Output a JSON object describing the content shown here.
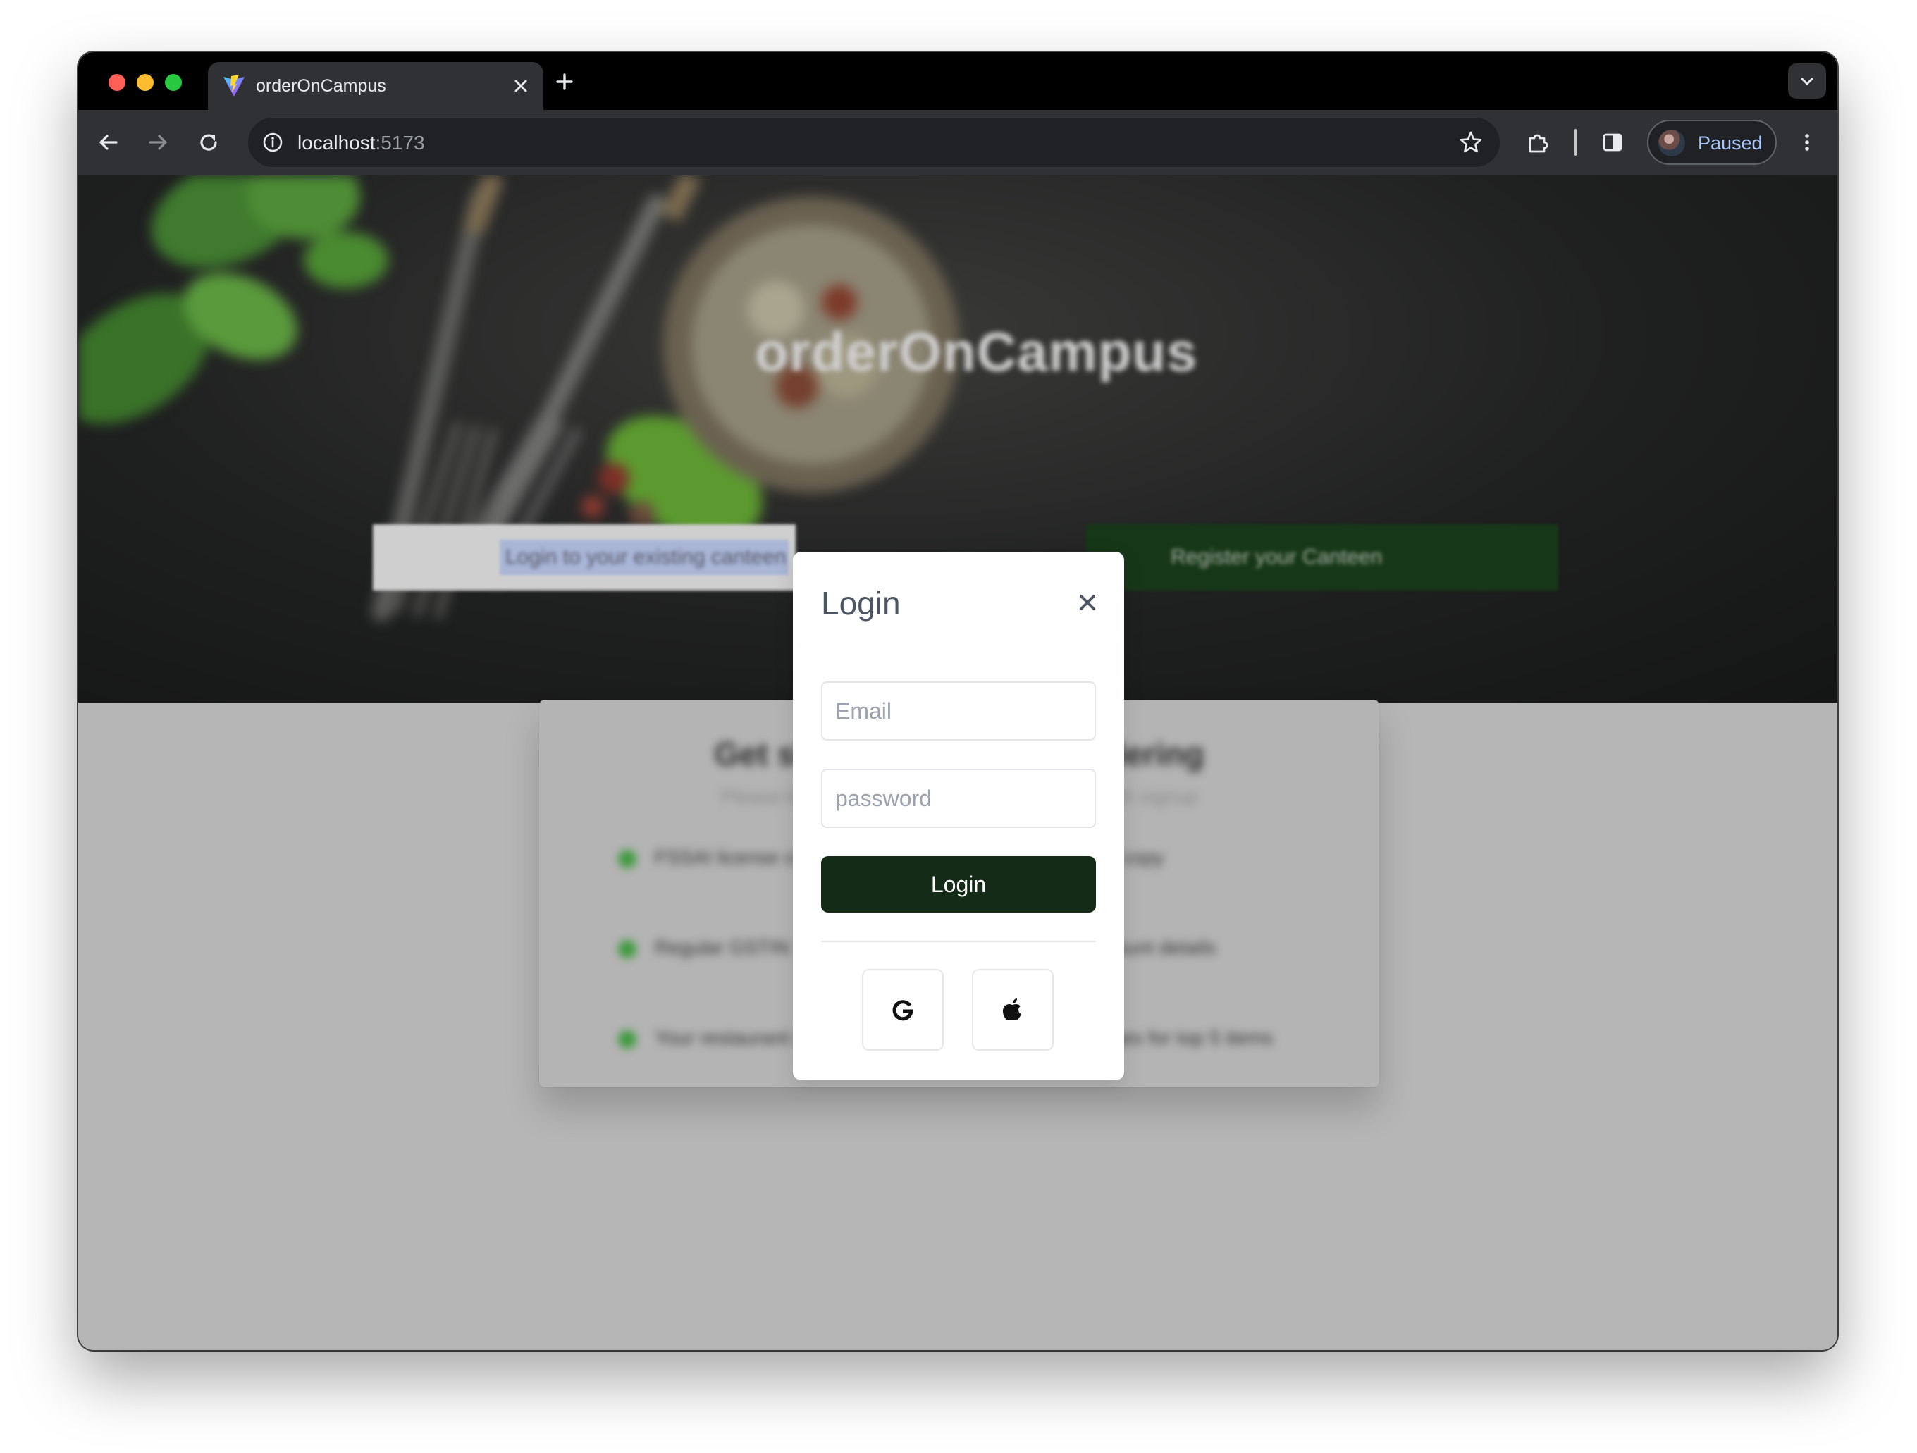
{
  "browser": {
    "tab": {
      "title": "orderOnCampus"
    },
    "address": {
      "host": "localhost",
      "port": ":5173"
    },
    "profile": {
      "label": "Paused"
    }
  },
  "page": {
    "brand": "orderOnCampus",
    "hero_buttons": {
      "existing": "Login to your existing canteen",
      "register": "Register your Canteen"
    },
    "card": {
      "title": "Get started with online ordering",
      "subtitle": "Please keep the documents ready for a smooth signup",
      "bullets_left": [
        "FSSAI license copy",
        "Regular GSTIN",
        "Your restaurant menu"
      ],
      "bullets_right": [
        "PAN card copy",
        "Bank account details",
        "Dish images for top 5 items"
      ]
    }
  },
  "modal": {
    "title": "Login",
    "email_placeholder": "Email",
    "password_placeholder": "password",
    "login_label": "Login",
    "social": [
      "google-icon",
      "apple-icon"
    ]
  },
  "colors": {
    "login_button": "#132b17",
    "register_button": "#173818",
    "bullet": "#3d9a3d",
    "profile_label": "#a8c7fa"
  }
}
